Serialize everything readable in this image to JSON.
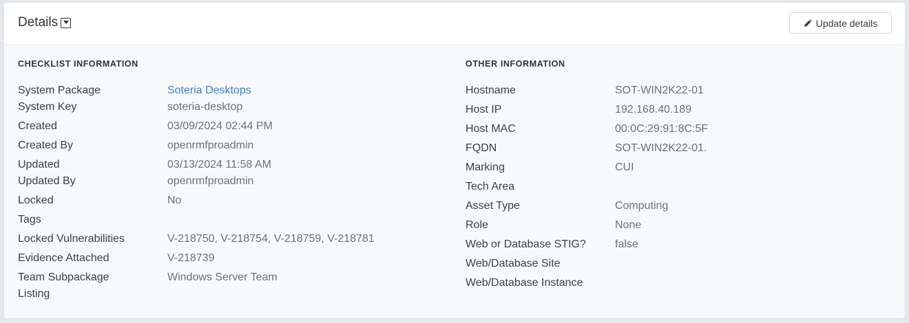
{
  "header": {
    "title": "Details",
    "update_button_label": "Update details"
  },
  "checklist_info": {
    "heading": "CHECKLIST INFORMATION",
    "rows": [
      {
        "key": "System Package",
        "value": "Soteria Desktops"
      },
      {
        "key": "System Key",
        "value": "soteria-desktop"
      },
      {
        "key": "Created",
        "value": "03/09/2024 02:44 PM"
      },
      {
        "key": "Created By",
        "value": "openrmfproadmin"
      },
      {
        "key": "Updated",
        "value": "03/13/2024 11:58 AM"
      },
      {
        "key": "Updated By",
        "value": "openrmfproadmin"
      },
      {
        "key": "Locked",
        "value": "No"
      },
      {
        "key": "Tags",
        "value": ""
      },
      {
        "key": "Locked Vulnerabilities",
        "value": "V-218750, V-218754, V-218759, V-218781"
      },
      {
        "key": "Evidence Attached",
        "value": "V-218739"
      },
      {
        "key": "Team Subpackage",
        "key2": "Listing",
        "value": "Windows Server Team"
      }
    ]
  },
  "other_info": {
    "heading": "OTHER INFORMATION",
    "rows": [
      {
        "key": "Hostname",
        "value": "SOT-WIN2K22-01"
      },
      {
        "key": "Host IP",
        "value": "192.168.40.189"
      },
      {
        "key": "Host MAC",
        "value": "00:0C:29:91:8C:5F"
      },
      {
        "key": "FQDN",
        "value": "SOT-WIN2K22-01."
      },
      {
        "key": "Marking",
        "value": "CUI"
      },
      {
        "key": "Tech Area",
        "value": ""
      },
      {
        "key": "Asset Type",
        "value": "Computing"
      },
      {
        "key": "Role",
        "value": "None"
      },
      {
        "key": "Web or Database STIG?",
        "value": "false"
      },
      {
        "key": "Web/Database Site",
        "value": ""
      },
      {
        "key": "Web/Database Instance",
        "value": ""
      }
    ]
  },
  "icons": {
    "title_toggle": "caret-down-square-icon",
    "update_button": "pencil-icon"
  },
  "colors": {
    "link": "#3f7fce",
    "background": "#f8f9fb"
  }
}
